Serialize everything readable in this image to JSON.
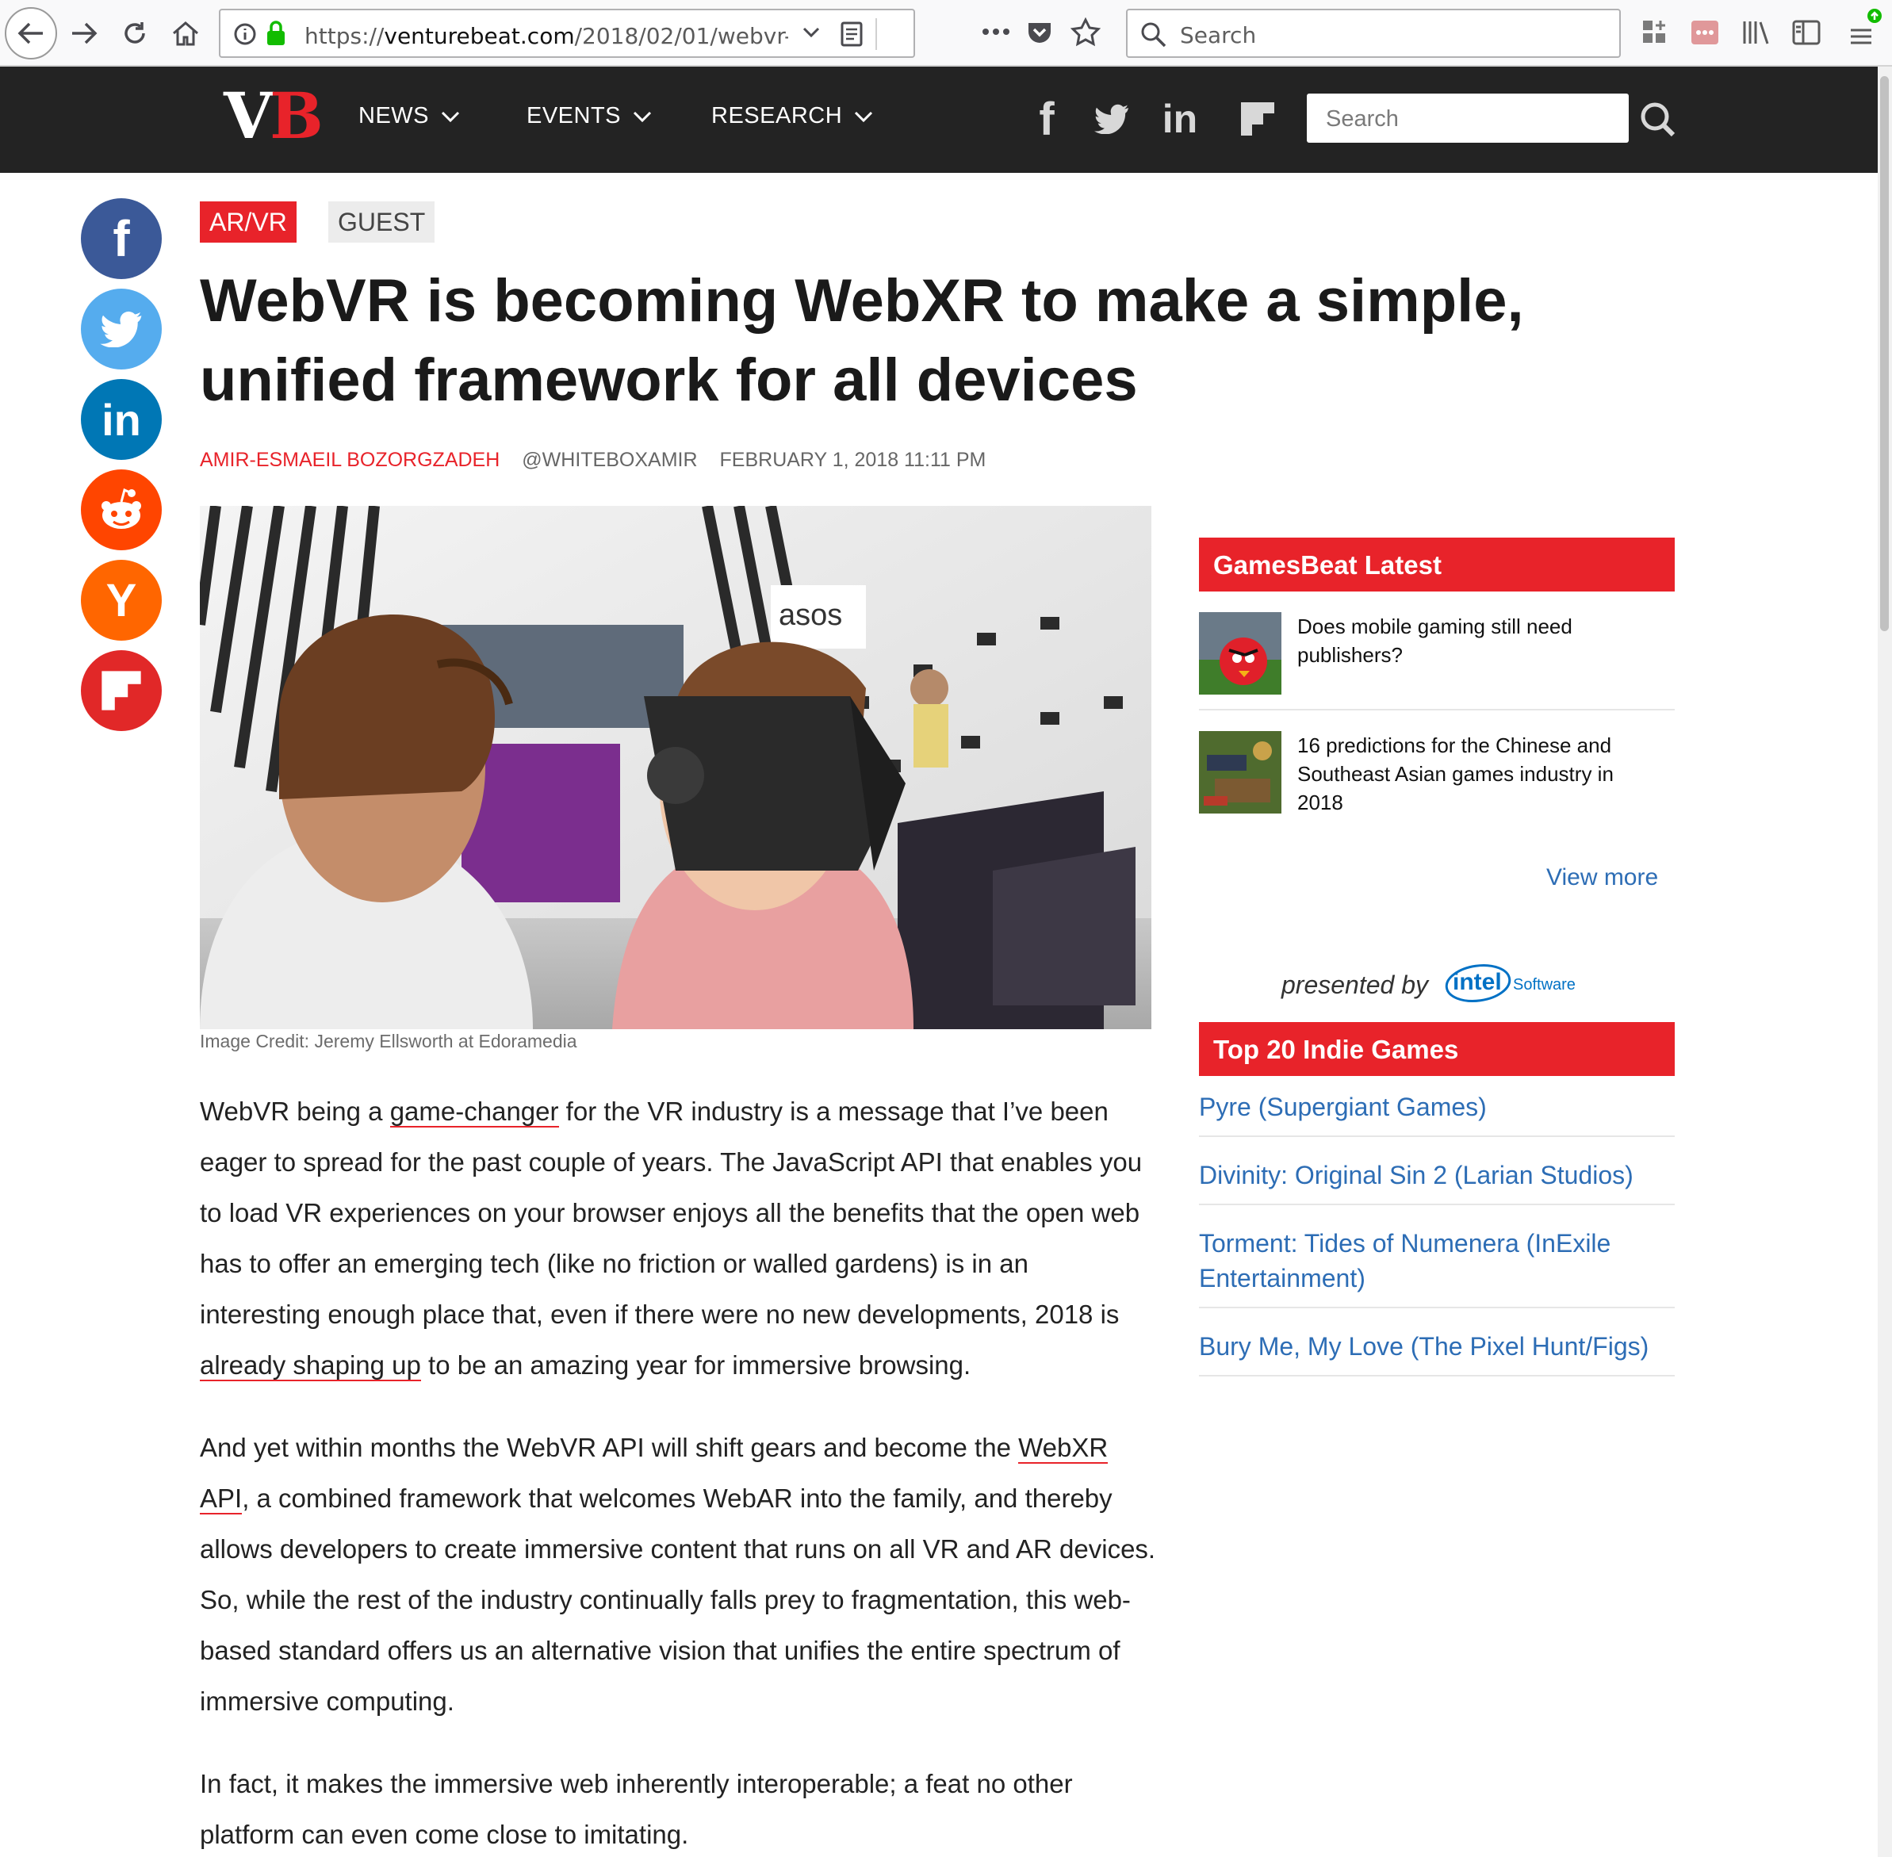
{
  "browser": {
    "url_prefix": "https://",
    "url_domain": "venturebeat.com",
    "url_path": "/2018/02/01/webvr-is-becomin",
    "search_placeholder": "Search"
  },
  "site": {
    "logo_v": "V",
    "logo_b": "B",
    "nav": [
      {
        "label": "NEWS"
      },
      {
        "label": "EVENTS"
      },
      {
        "label": "RESEARCH"
      }
    ],
    "social": {
      "facebook": "f",
      "linkedin": "in"
    },
    "search_placeholder": "Search"
  },
  "share": {
    "facebook": "f",
    "linkedin": "in",
    "hackernews": "Y"
  },
  "article": {
    "tags": [
      "AR/VR",
      "GUEST"
    ],
    "title": "WebVR is becoming WebXR to make a simple, unified framework for all devices",
    "author": "AMIR-ESMAEIL BOZORGZADEH",
    "handle": "@WHITEBOXAMIR",
    "date": "FEBRUARY 1, 2018 11:11 PM",
    "image_credit": "Image Credit: Jeremy Ellsworth at Edoramedia",
    "p1_a": "WebVR being a ",
    "p1_link1": "game-changer",
    "p1_b": " for the VR industry is a message that I’ve been eager to spread for the past couple of years. The JavaScript API that enables you to load VR experiences on your browser enjoys all the benefits that the open web has to offer an emerging tech (like no friction or walled gardens) is in an interesting enough place that, even if there were no new developments, 2018 is ",
    "p1_link2": "already shaping up",
    "p1_c": " to be an amazing year for immersive browsing.",
    "p2_a": "And yet within months the WebVR API will shift gears and become the ",
    "p2_link": "WebXR API",
    "p2_b": ", a combined framework that welcomes WebAR into the family, and thereby allows developers to create immersive content that runs on all VR and AR devices. So, while the rest of the industry continually falls prey to fragmentation, this web-based standard offers us an alternative vision that unifies the entire spectrum of immersive computing.",
    "p3": "In fact, it makes the immersive web inherently interoperable; a feat no other platform can even come close to imitating."
  },
  "sidebar": {
    "gamesbeat_title": "GamesBeat Latest",
    "gamesbeat_items": [
      {
        "title": "Does mobile gaming still need publishers?"
      },
      {
        "title": "16 predictions for the Chinese and Southeast Asian games industry in 2018"
      }
    ],
    "view_more": "View more",
    "presented_by": "presented by",
    "sponsor_brand": "intel",
    "sponsor_suffix": "Software",
    "indie_title": "Top 20 Indie Games",
    "indie_items": [
      {
        "label": "Pyre (Supergiant Games)"
      },
      {
        "label": "Divinity: Original Sin 2 (Larian Studios)"
      },
      {
        "label": "Torment: Tides of Numenera (InExile Entertainment)"
      },
      {
        "label": "Bury Me, My Love (The Pixel Hunt/Figs)"
      }
    ]
  },
  "colors": {
    "accent": "#e8232a",
    "link": "#2d6db5",
    "nav_bg": "#232323"
  }
}
